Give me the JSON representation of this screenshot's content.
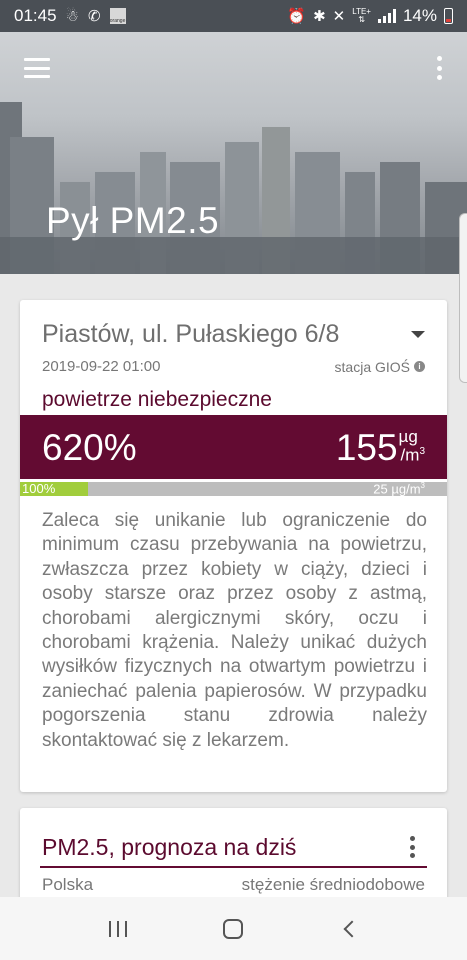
{
  "status_bar": {
    "time": "01:45",
    "carrier_icon_text": "orange",
    "network": "LTE+",
    "battery": "14%"
  },
  "header": {
    "title": "Pył PM2.5"
  },
  "station": {
    "name": "Piastów, ul. Pułaskiego 6/8",
    "datetime": "2019-09-22 01:00",
    "source": "stacja GIOŚ"
  },
  "air_quality": {
    "label": "powietrze niebezpieczne",
    "percent_of_norm": "620%",
    "concentration_value": "155",
    "unit_num": "µg",
    "unit_den": "/m",
    "unit_exp": "3",
    "band_color": "#630b32",
    "progress": {
      "fill_label": "100%",
      "fill_fraction": 0.16,
      "fill_color": "#a1cd3c",
      "norm_value": "25",
      "norm_unit": "µg/m",
      "norm_exp": "3"
    },
    "advice": "Zaleca się unikanie lub ograniczenie do minimum czasu przebywania na powietrzu, zwłaszcza przez kobiety w ciąży, dzieci i osoby starsze oraz przez osoby z astmą, chorobami alergicznymi skóry, oczu i chorobami krążenia. Należy unikać dużych wysiłków fizycznych na otwartym powietrzu i zaniechać palenia papierosów. W przypadku pogorszenia stanu zdrowia należy skontaktować się z lekarzem."
  },
  "forecast": {
    "title": "PM2.5, prognoza na dziś",
    "region": "Polska",
    "metric": "stężenie średniodobowe"
  },
  "icons": {
    "menu": "hamburger-menu-icon",
    "more": "more-vert-icon",
    "dropdown": "caret-down-icon",
    "info": "info-icon",
    "nav_recent": "recent-apps-icon",
    "nav_home": "home-icon",
    "nav_back": "back-icon"
  }
}
